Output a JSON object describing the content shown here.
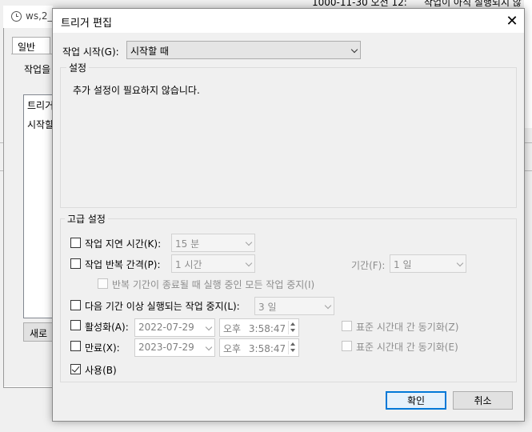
{
  "background": {
    "window_title": "ws,2_i",
    "tab_general": "일반",
    "label_task": "작업을",
    "list_header": "트리거",
    "list_row": "시작할",
    "new_button": "새로",
    "top_text_left": "1000-11-30 오전 12:",
    "top_text_right": "작업이 아직 실행되지 않"
  },
  "dialog": {
    "title": "트리거 편집",
    "close_glyph": "✕",
    "begin_label": "작업 시작(G):",
    "begin_value": "시작할 때",
    "settings_group": "설정",
    "settings_text": "추가 설정이 필요하지 않습니다.",
    "advanced_group": "고급 설정",
    "delay_label": "작업 지연 시간(K):",
    "delay_value": "15 분",
    "repeat_label": "작업 반복 간격(P):",
    "repeat_value": "1 시간",
    "duration_label": "기간(F):",
    "duration_value": "1 일",
    "stop_all_label": "반복 기간이 종료될 때 실행 중인 모든 작업 중지(I)",
    "stop_longer_label": "다음 기간 이상 실행되는 작업 중지(L):",
    "stop_longer_value": "3 일",
    "activate_label": "활성화(A):",
    "activate_date": "2022-07-29",
    "activate_time_ampm": "오후",
    "activate_time": "3:58:47",
    "activate_sync_label": "표준 시간대 간 동기화(Z)",
    "expire_label": "만료(X):",
    "expire_date": "2023-07-29",
    "expire_time_ampm": "오후",
    "expire_time": "3:58:47",
    "expire_sync_label": "표준 시간대 간 동기화(E)",
    "enabled_label": "사용(B)",
    "ok_button": "확인",
    "cancel_button": "취소"
  },
  "state": {
    "delay_checked": false,
    "repeat_checked": false,
    "stop_all_checked": false,
    "stop_longer_checked": false,
    "activate_checked": false,
    "expire_checked": false,
    "enabled_checked": true
  },
  "colors": {
    "accent": "#0078d7",
    "dialog_bg": "#f0f0f0",
    "disabled_text": "#8d8d8d"
  }
}
